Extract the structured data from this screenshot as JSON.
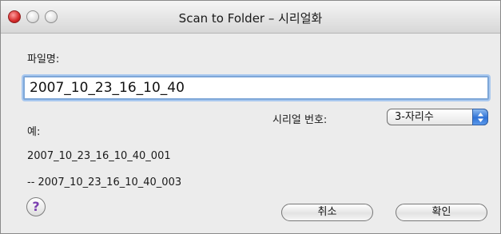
{
  "window": {
    "title": "Scan to Folder – 시리얼화"
  },
  "filename": {
    "label": "파일명:",
    "value": "2007_10_23_16_10_40"
  },
  "serial": {
    "label": "시리얼 번호:",
    "selected": "3-자리수"
  },
  "example": {
    "label": "예:",
    "first": "2007_10_23_16_10_40_001",
    "last": "-- 2007_10_23_16_10_40_003"
  },
  "buttons": {
    "help": "?",
    "cancel": "취소",
    "ok": "확인"
  },
  "icons": {
    "close": "close-icon",
    "minimize": "minimize-icon",
    "zoom": "zoom-icon",
    "select_arrows": "up-down-arrows-icon",
    "help": "help-icon"
  },
  "colors": {
    "accent": "#3a7bd5",
    "focus_ring": "#a9c8ef",
    "close": "#d42a2a"
  }
}
